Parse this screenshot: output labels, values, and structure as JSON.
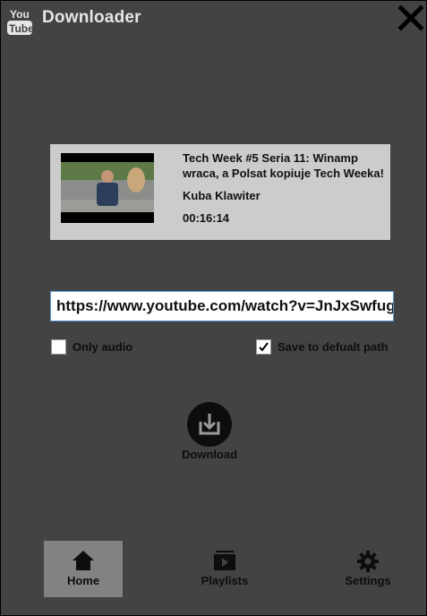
{
  "app": {
    "title": "Downloader",
    "logo_text_top": "You",
    "logo_text_bottom": "Tube"
  },
  "video": {
    "title": "Tech Week #5 Seria 11: Winamp wraca, a Polsat kopiuje Tech Weeka!",
    "author": "Kuba Klawiter",
    "duration": "00:16:14"
  },
  "url_field": {
    "value": "https://www.youtube.com/watch?v=JnJxSwfugjw",
    "placeholder": ""
  },
  "options": {
    "only_audio": {
      "label": "Only audio",
      "checked": false
    },
    "default_path": {
      "label": "Save to defualt path",
      "checked": true
    }
  },
  "download": {
    "label": "Download"
  },
  "nav": {
    "home": {
      "label": "Home",
      "active": true
    },
    "playlists": {
      "label": "Playlists",
      "active": false
    },
    "settings": {
      "label": "Settings",
      "active": false
    }
  },
  "colors": {
    "background": "#434343",
    "card": "#cccccc",
    "nav_active": "#828282",
    "input_border": "#5b9bd5",
    "text_dark": "#0d0d0d",
    "title_text": "#e6e6e6"
  }
}
